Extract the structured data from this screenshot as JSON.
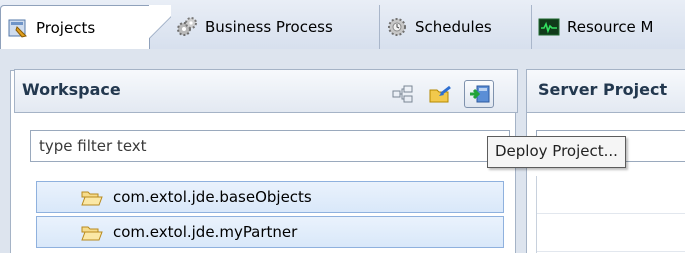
{
  "tabs": [
    {
      "label": "Projects",
      "icon": "projects-icon",
      "active": true
    },
    {
      "label": "Business Process",
      "icon": "gears-icon",
      "active": false
    },
    {
      "label": "Schedules",
      "icon": "schedule-gears-icon",
      "active": false
    },
    {
      "label": "Resource M",
      "icon": "resource-monitor-icon",
      "active": false
    }
  ],
  "workspace": {
    "title": "Workspace",
    "filter_placeholder": "type filter text",
    "items": [
      {
        "label": "com.extol.jde.baseObjects",
        "icon": "folder-icon"
      },
      {
        "label": "com.extol.jde.myPartner",
        "icon": "folder-icon"
      }
    ],
    "toolbar": {
      "collapse_icon": "tree-collapse-icon",
      "import_icon": "import-folder-icon",
      "deploy_icon": "deploy-project-icon"
    }
  },
  "server": {
    "title": "Server Project"
  },
  "tooltip": {
    "text": "Deploy Project..."
  },
  "colors": {
    "header_text": "#23384f",
    "selection_fill": "#d9e8fa",
    "selection_border": "#8fb1de",
    "panel_border": "#a5b3c6"
  }
}
